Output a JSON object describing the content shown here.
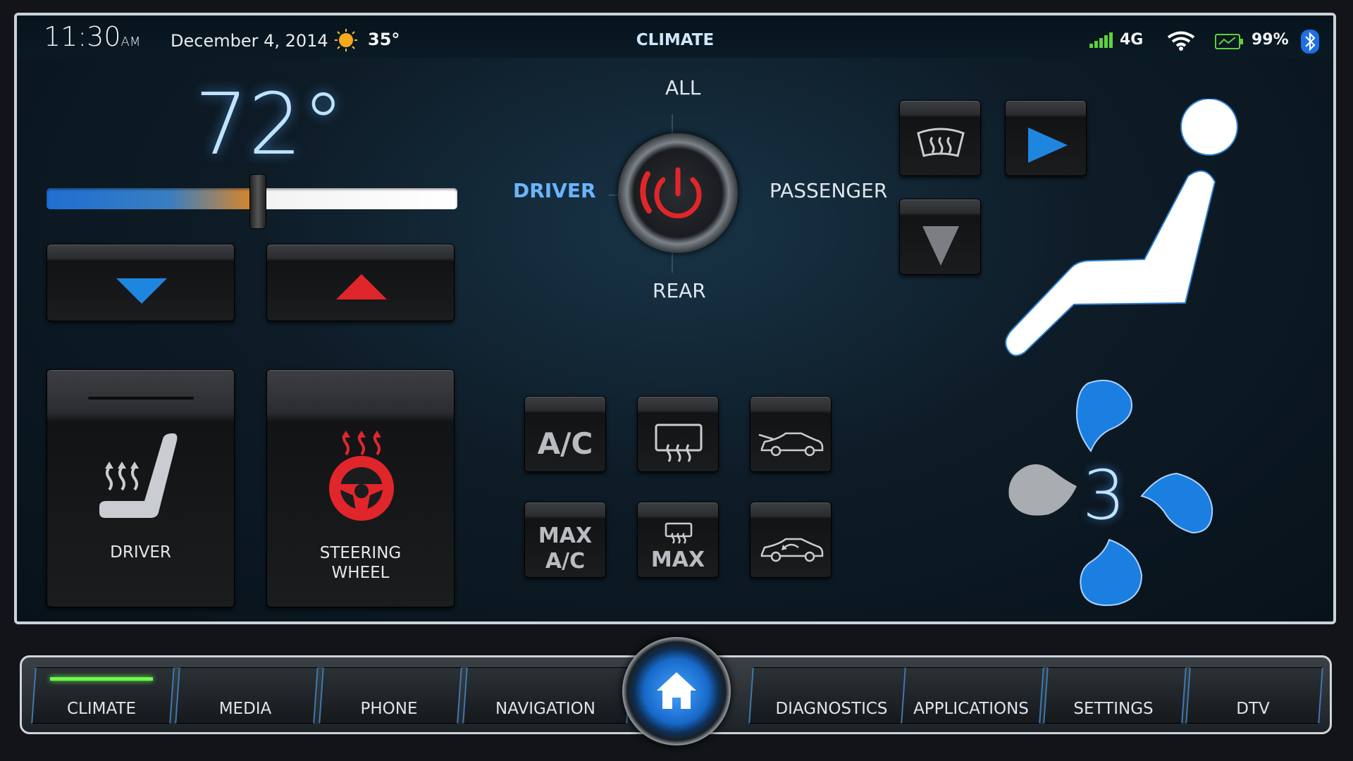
{
  "status": {
    "time": "11:30",
    "ampm": "AM",
    "date": "December 4, 2014",
    "weather_icon": "sun-icon",
    "outside_temp": "35°",
    "title": "CLIMATE",
    "network": "4G",
    "battery": "99%"
  },
  "climate": {
    "set_temp": "72°",
    "temp_slider_level_percent": 50,
    "zones": {
      "all": "ALL",
      "driver": "DRIVER",
      "passenger": "PASSENGER",
      "rear": "REAR"
    },
    "active_zone": "DRIVER",
    "fan_speed": "3",
    "seat_heat_label": "DRIVER",
    "wheel_heat_label_1": "STEERING",
    "wheel_heat_label_2": "WHEEL",
    "modes": {
      "ac": "A/C",
      "max_ac_1": "MAX",
      "max_ac_2": "A/C",
      "max_defrost": "MAX"
    }
  },
  "nav": {
    "items": [
      "CLIMATE",
      "MEDIA",
      "PHONE",
      "NAVIGATION",
      "DIAGNOSTICS",
      "APPLICATIONS",
      "SETTINGS",
      "DTV"
    ],
    "active": "CLIMATE"
  },
  "colors": {
    "accent_blue": "#1f86e0",
    "heat_red": "#e0262a",
    "active_green": "#6cff4a"
  }
}
